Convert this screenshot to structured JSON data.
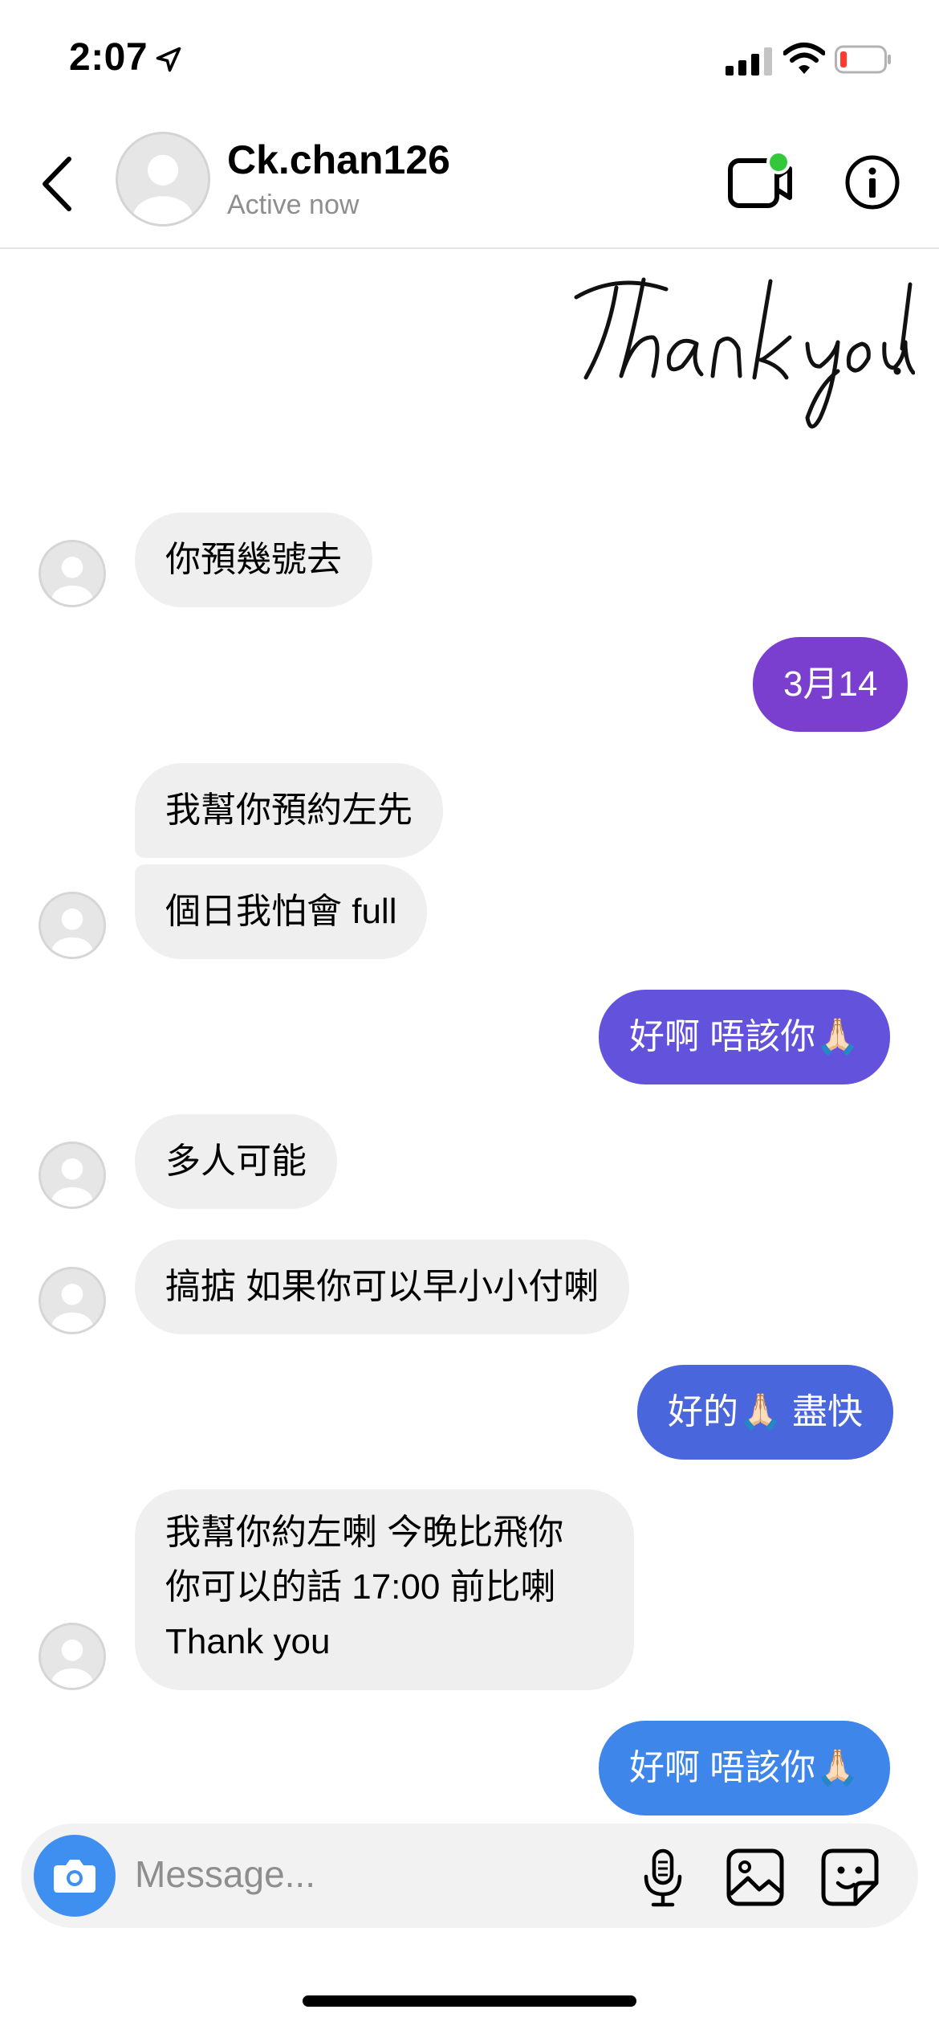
{
  "status": {
    "time": "2:07",
    "battery_level": 0.15
  },
  "header": {
    "username": "Ck.chan126",
    "status_text": "Active now"
  },
  "sticker_text": "Thank you!",
  "messages": [
    {
      "from": "them",
      "text": "你預幾號去"
    },
    {
      "from": "me",
      "text": "3月14"
    },
    {
      "from": "them",
      "text": "我幫你預約左先"
    },
    {
      "from": "them",
      "text": "個日我怕會 full"
    },
    {
      "from": "me",
      "text": "好啊 唔該你🙏🏻"
    },
    {
      "from": "them",
      "text": "多人可能"
    },
    {
      "from": "them",
      "text": "搞掂 如果你可以早小小付喇"
    },
    {
      "from": "me",
      "text": "好的🙏🏻 盡快"
    },
    {
      "from": "them",
      "lines": [
        "我幫你約左喇 今晚比飛你",
        "你可以的話 17:00 前比喇",
        "Thank you"
      ]
    },
    {
      "from": "me",
      "text": "好啊 唔該你🙏🏻"
    }
  ],
  "composer": {
    "placeholder": "Message..."
  },
  "colors": {
    "accent_blue": "#3f8ff0",
    "bubble_incoming": "#efefef",
    "online_dot": "#32c83a"
  }
}
